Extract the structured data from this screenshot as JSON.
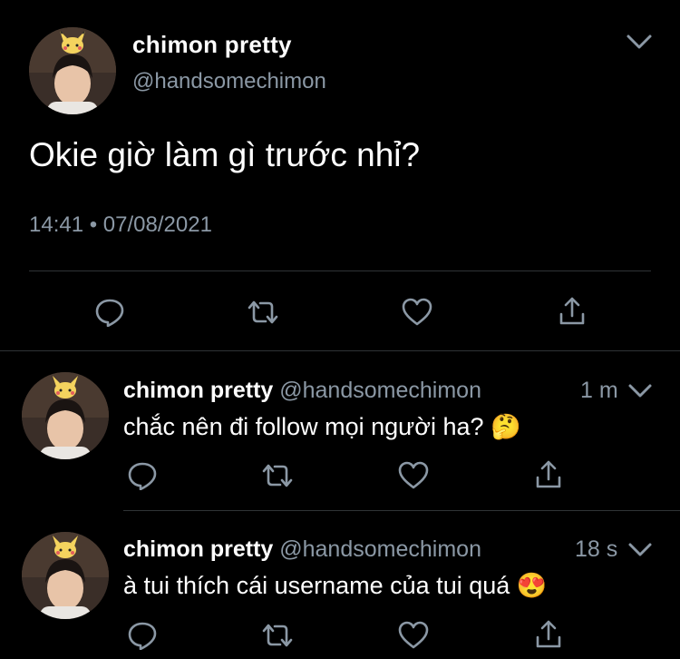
{
  "main_tweet": {
    "display_name": "chimon pretty",
    "handle": "@handsomechimon",
    "text": "Okie giờ làm gì trước nhỉ?",
    "timestamp": "14:41 • 07/08/2021"
  },
  "replies": [
    {
      "display_name": "chimon pretty",
      "handle": "@handsomechimon",
      "age": "1 m",
      "text": "chắc nên đi follow mọi người ha?",
      "emoji": "🤔"
    },
    {
      "display_name": "chimon pretty",
      "handle": "@handsomechimon",
      "age": "18 s",
      "text": "à tui thích cái username của tui quá",
      "emoji": "😍"
    }
  ],
  "icons": {
    "more": "chevron-down-icon",
    "reply": "reply-icon",
    "retweet": "retweet-icon",
    "like": "heart-icon",
    "share": "share-icon"
  },
  "colors": {
    "background": "#000000",
    "text": "#ffffff",
    "muted": "#8b98a5",
    "icon": "#8b98a5",
    "divider": "#2f3336"
  }
}
